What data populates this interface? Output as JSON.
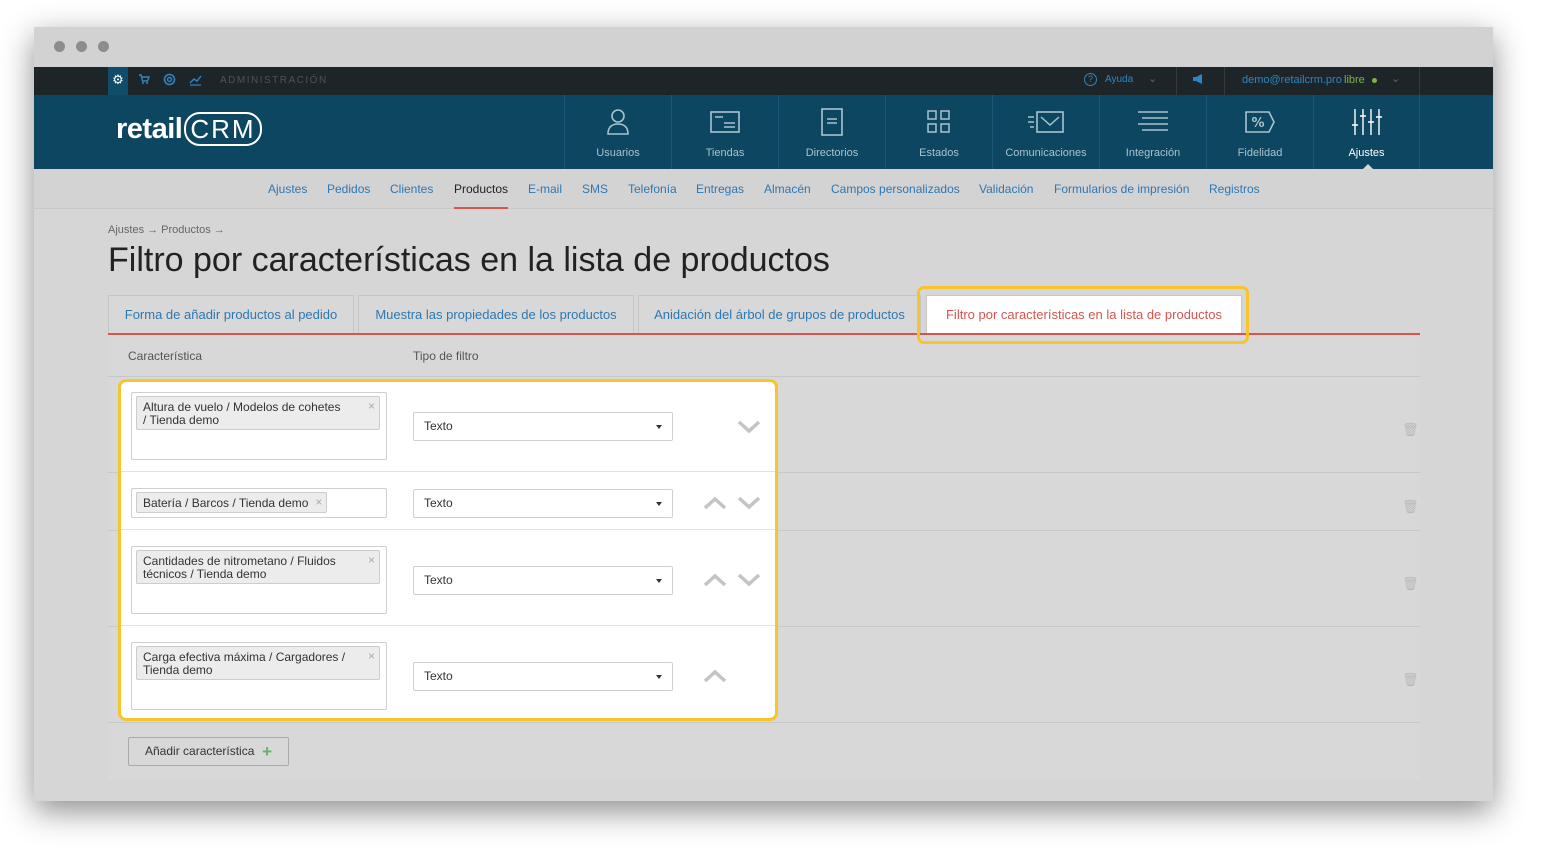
{
  "topbar": {
    "admin_label": "ADMINISTRACIÓN",
    "help_label": "Ayuda",
    "user_email": "demo@retailcrm.pro",
    "user_plan": "libre"
  },
  "logo": {
    "text_main": "retail",
    "text_crm": "CRM"
  },
  "main_nav": [
    {
      "label": "Usuarios",
      "icon": "user-icon"
    },
    {
      "label": "Tiendas",
      "icon": "store-icon"
    },
    {
      "label": "Directorios",
      "icon": "document-icon"
    },
    {
      "label": "Estados",
      "icon": "grid-icon"
    },
    {
      "label": "Comunicaciones",
      "icon": "envelope-icon"
    },
    {
      "label": "Integración",
      "icon": "lines-icon"
    },
    {
      "label": "Fidelidad",
      "icon": "percent-tag-icon"
    },
    {
      "label": "Ajustes",
      "icon": "sliders-icon",
      "active": true
    }
  ],
  "sub_nav": [
    "Ajustes",
    "Pedidos",
    "Clientes",
    "Productos",
    "E-mail",
    "SMS",
    "Telefonía",
    "Entregas",
    "Almacén",
    "Campos personalizados",
    "Validación",
    "Formularios de impresión",
    "Registros"
  ],
  "sub_nav_active": "Productos",
  "breadcrumb": "Ajustes → Productos →",
  "page_title": "Filtro por características en la lista de productos",
  "tabs": [
    "Forma de añadir productos al pedido",
    "Muestra las propiedades de los productos",
    "Anidación del árbol de grupos de productos",
    "Filtro por características en la lista de productos"
  ],
  "active_tab": "Filtro por características en la lista de productos",
  "table": {
    "col_characteristic": "Característica",
    "col_filter_type": "Tipo de filtro",
    "rows": [
      {
        "line1": "Altura de vuelo / Modelos de cohetes",
        "line2": "/ Tienda demo",
        "filter": "Texto",
        "up": false,
        "down": true
      },
      {
        "line1": "Batería / Barcos / Tienda demo",
        "line2": "",
        "filter": "Texto",
        "up": true,
        "down": true
      },
      {
        "line1": "Cantidades de nitrometano / Fluidos",
        "line2": "técnicos / Tienda demo",
        "filter": "Texto",
        "up": true,
        "down": true
      },
      {
        "line1": "Carga efectiva máxima / Cargadores /",
        "line2": "Tienda demo",
        "filter": "Texto",
        "up": true,
        "down": false
      }
    ]
  },
  "add_button_label": "Añadir característica",
  "colors": {
    "accent_red": "#d9534f",
    "highlight_yellow": "#f7c52b",
    "nav_bg": "#0d4660",
    "link_blue": "#2c79b3"
  }
}
